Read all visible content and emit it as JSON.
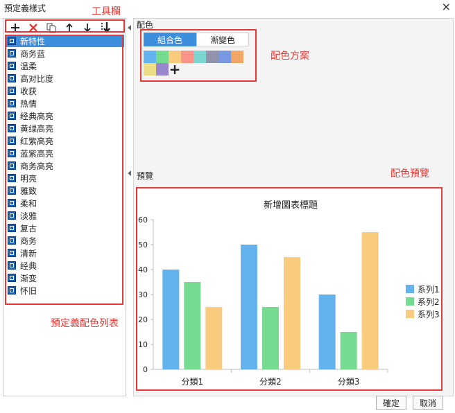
{
  "window": {
    "title": "預定義樣式",
    "close_label": "×"
  },
  "toolbar": {
    "buttons": [
      {
        "name": "add-button",
        "icon": "plus-icon"
      },
      {
        "name": "delete-button",
        "icon": "close-x-icon"
      },
      {
        "name": "copy-button",
        "icon": "copy-icon"
      },
      {
        "name": "move-up-button",
        "icon": "arrow-up-icon"
      },
      {
        "name": "move-down-button",
        "icon": "arrow-down-icon"
      },
      {
        "name": "move-bottom-button",
        "icon": "arrow-bottom-icon"
      }
    ]
  },
  "style_list": {
    "items": [
      "新特性",
      "商务蓝",
      "温柔",
      "高对比度",
      "收获",
      "热情",
      "经典高亮",
      "黄绿高亮",
      "红紫高亮",
      "蓝紫高亮",
      "商务高亮",
      "明亮",
      "雅致",
      "柔和",
      "淡雅",
      "复古",
      "商务",
      "清新",
      "经典",
      "渐变",
      "怀旧"
    ],
    "selected_index": 0
  },
  "color_section": {
    "label": "配色",
    "tabs": [
      "組合色",
      "漸變色"
    ],
    "active_tab": 0,
    "swatches": [
      "#63b2ee",
      "#76da91",
      "#f8cb7f",
      "#f89588",
      "#7cd6cf",
      "#9192ab",
      "#7898e1",
      "#efa666",
      "#eddd86",
      "#9987ce"
    ],
    "add_label": "+"
  },
  "preview": {
    "label": "預覽"
  },
  "chart_data": {
    "type": "bar",
    "title": "新增圖表標題",
    "categories": [
      "分類1",
      "分類2",
      "分類3"
    ],
    "series": [
      {
        "name": "系列1",
        "color": "#63b2ee",
        "values": [
          40,
          50,
          30
        ]
      },
      {
        "name": "系列2",
        "color": "#76da91",
        "values": [
          35,
          25,
          15
        ]
      },
      {
        "name": "系列3",
        "color": "#f8cb7f",
        "values": [
          25,
          45,
          55
        ]
      }
    ],
    "ylim": [
      0,
      60
    ],
    "yticks": [
      0,
      10,
      20,
      30,
      40,
      50,
      60
    ],
    "legend": "right",
    "grid": false
  },
  "annotations": {
    "toolbar_label": "工具欄",
    "scheme_label": "配色方案",
    "preview_label": "配色預覽",
    "list_label": "預定義配色列表"
  },
  "footer": {
    "ok_label": "確定",
    "cancel_label": "取消"
  }
}
